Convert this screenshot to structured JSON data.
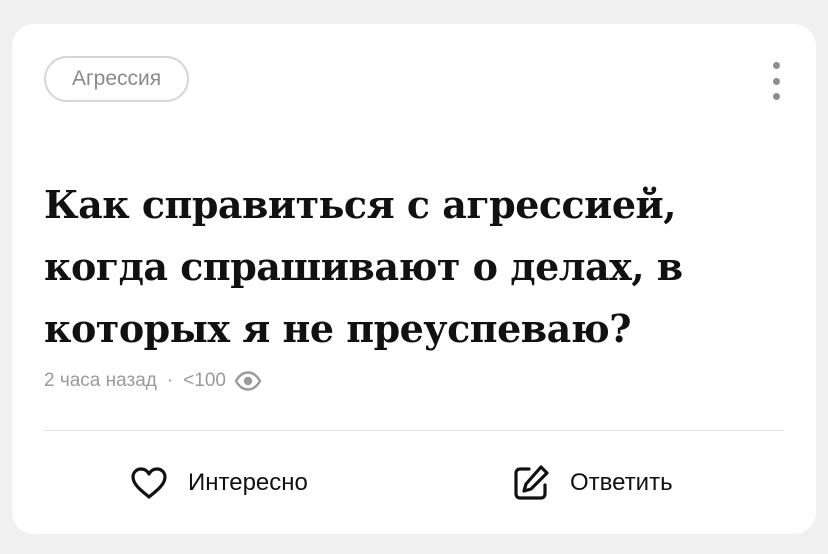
{
  "card": {
    "tag_label": "Агрессия",
    "title": "Как справиться с агрессией, когда спрашивают о делах, в которых я не преуспеваю?",
    "meta": {
      "time": "2 часа назад",
      "separator": "·",
      "views": "<100",
      "views_icon": "eye-icon"
    },
    "more_icon": "vertical-dots-icon",
    "actions": {
      "like_label": "Интересно",
      "like_icon": "heart-outline-icon",
      "reply_label": "Ответить",
      "reply_icon": "edit-pencil-icon"
    }
  },
  "colors": {
    "page_bg": "#f0f0f0",
    "card_bg": "#ffffff",
    "text": "#111111",
    "muted": "#9a9a9a",
    "border": "#d6d6d6"
  }
}
